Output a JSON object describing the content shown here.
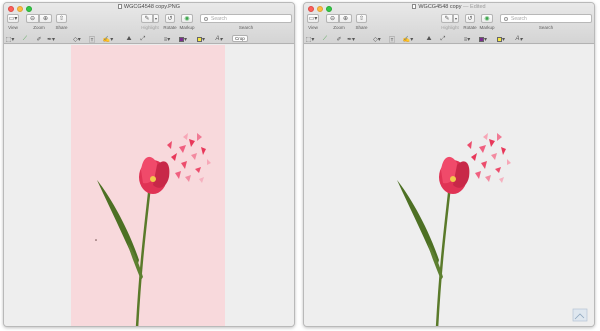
{
  "windows": {
    "left": {
      "title": "WGCG4548 copy.PNG",
      "edited_suffix": "",
      "photo_background": "#f8d9dc"
    },
    "right": {
      "title": "WGCG4548 copy",
      "edited_suffix": " — Edited",
      "photo_background": "#eeeeee"
    }
  },
  "toolbar": {
    "view_label": "View",
    "zoom_label": "Zoom",
    "share_label": "Share",
    "highlight_label": "Highlight",
    "rotate_label": "Rotate",
    "markup_label": "Markup",
    "search_label": "Search",
    "search_placeholder": "Search"
  },
  "markup": {
    "crop_label": "Crop",
    "text_style_glyph": "A"
  },
  "icons": [
    "sidebar-icon",
    "zoom-out-icon",
    "zoom-in-icon",
    "share-icon",
    "pen-icon",
    "rotate-icon",
    "markup-icon",
    "search-icon",
    "selection-icon",
    "sketch-icon",
    "draw-icon",
    "shapes-icon",
    "text-icon",
    "sign-icon",
    "adjust-color-icon",
    "adjust-size-icon",
    "shape-style-icon",
    "border-color-icon",
    "fill-color-icon",
    "text-style-icon"
  ],
  "colors": {
    "border_color_swatch": "#7b2c8f",
    "fill_color_swatch": "#f5e642",
    "tulip": "#e8385a",
    "stem": "#5a7a2a"
  }
}
